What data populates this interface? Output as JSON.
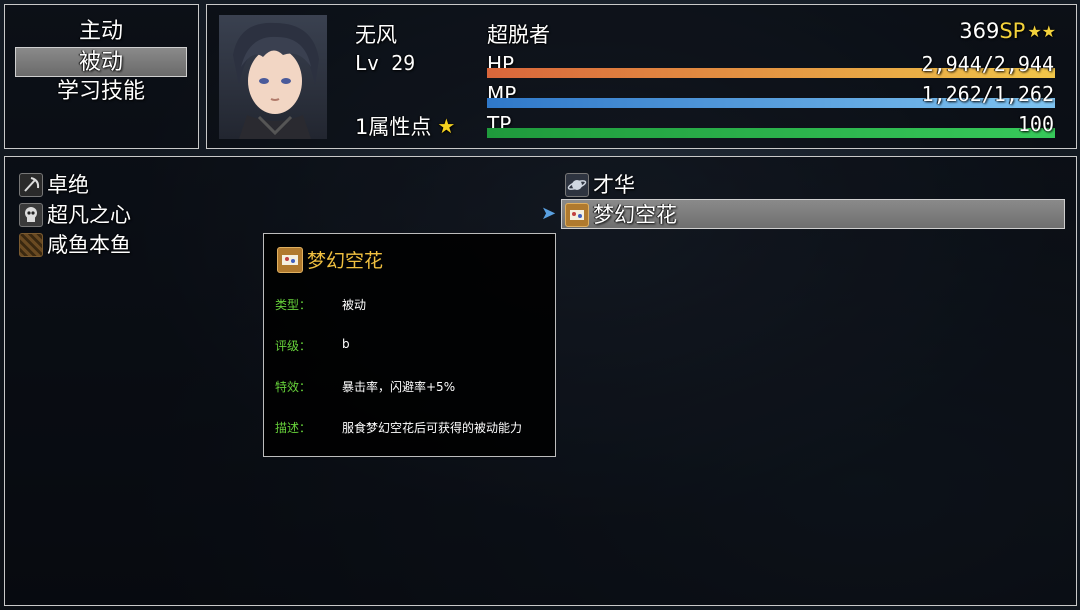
{
  "command_menu": {
    "items": [
      {
        "label": "主动"
      },
      {
        "label": "被动"
      },
      {
        "label": "学习技能"
      }
    ]
  },
  "actor": {
    "name": "无风",
    "level": "Lv 29",
    "class": "超脱者",
    "attribute_points": "1属性点",
    "sp_value": "369",
    "sp_label": "SP",
    "hp": {
      "label": "HP",
      "value": "2,944/2,944",
      "fraction": 1.0
    },
    "mp": {
      "label": "MP",
      "value": "1,262/1,262",
      "fraction": 1.0
    },
    "tp": {
      "label": "TP",
      "value": "100",
      "fraction": 1.0
    }
  },
  "skills": [
    {
      "label": "卓绝",
      "icon": "crescent-sword-icon"
    },
    {
      "label": "超凡之心",
      "icon": "skull-icon"
    },
    {
      "label": "咸鱼本鱼",
      "icon": "pattern-icon"
    },
    {
      "label": "才华",
      "icon": "planet-icon"
    },
    {
      "label": "梦幻空花",
      "icon": "flower-scroll-icon"
    }
  ],
  "tooltip": {
    "title": "梦幻空花",
    "rows": [
      {
        "key": "类型：",
        "value": "被动"
      },
      {
        "key": "评级：",
        "value": "b"
      },
      {
        "key": "特效：",
        "value": "暴击率，闪避率+5%"
      },
      {
        "key": "描述：",
        "value": "服食梦幻空花后可获得的被动能力"
      }
    ]
  },
  "colors": {
    "hp_gradient": [
      "#d9663b",
      "#f0c64a"
    ],
    "mp_gradient": [
      "#2f78c9",
      "#7fc3f0"
    ],
    "tp_gradient": [
      "#1f9a3c",
      "#37c95a"
    ],
    "sp_label": "#f3d23c",
    "tooltip_key": "#66d13a",
    "tooltip_title": "#f0c040"
  }
}
